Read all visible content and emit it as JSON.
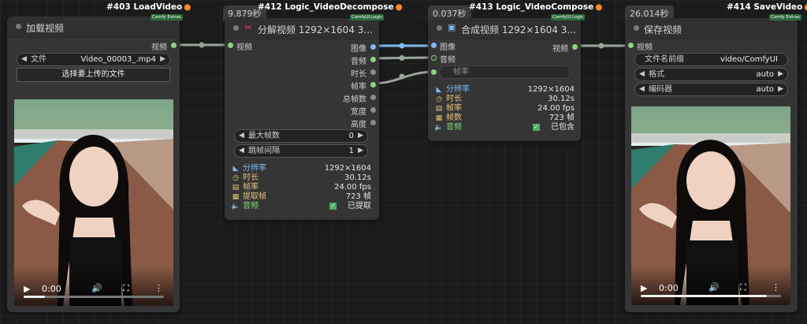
{
  "colors": {
    "accent_green": "#8cd37f",
    "accent_blue": "#7fb8ef",
    "node_bg": "#353535",
    "canvas_bg": "#1b1b1b"
  },
  "nodes": {
    "load_video": {
      "badge": "#403 LoadVideo",
      "tag": "Comfy Extras",
      "title": "加载视频",
      "output_label": "视频",
      "file_widget": {
        "label": "文件",
        "value": "Video_00003_.mp4"
      },
      "upload_button": "选择要上传的文件",
      "player": {
        "time": "0:00",
        "progress": 0.15
      }
    },
    "decompose": {
      "timing": "9.879秒",
      "badge": "#412 Logic_VideoDecompose",
      "tag": "ComfyUI.Logic",
      "title": "分解视频 1292×1604 3...",
      "input_label": "视频",
      "outputs": [
        "图像",
        "音频",
        "时长",
        "帧率",
        "总帧数",
        "宽度",
        "高度"
      ],
      "widgets": [
        {
          "label": "最大帧数",
          "value": "0"
        },
        {
          "label": "跳帧间隔",
          "value": "1"
        }
      ],
      "info": [
        {
          "icon": "ruler-icon",
          "key": "分辨率",
          "value": "1292×1604",
          "color": "#7fb8ef"
        },
        {
          "icon": "clock-icon",
          "key": "时长",
          "value": "30.12s",
          "color": "#e6c37a"
        },
        {
          "icon": "film-icon",
          "key": "帧率",
          "value": "24.00 fps",
          "color": "#e6c37a"
        },
        {
          "icon": "image-icon",
          "key": "提取帧",
          "value": "723 帧",
          "color": "#e6c37a"
        },
        {
          "icon": "speaker-icon",
          "key": "音频",
          "value": "已提取",
          "color": "#8cd37f"
        }
      ]
    },
    "compose": {
      "timing": "0.037秒",
      "badge": "#413 Logic_VideoCompose",
      "tag": "ComfyUI.Logic",
      "title": "合成视频 1292×1604 3...",
      "inputs": [
        "图像",
        "音频"
      ],
      "fps_placeholder": "帧率",
      "output_label": "视频",
      "info": [
        {
          "icon": "ruler-icon",
          "key": "分辨率",
          "value": "1292×1604",
          "color": "#7fb8ef"
        },
        {
          "icon": "clock-icon",
          "key": "时长",
          "value": "30.12s",
          "color": "#e6c37a"
        },
        {
          "icon": "film-icon",
          "key": "帧率",
          "value": "24.00 fps",
          "color": "#e6c37a"
        },
        {
          "icon": "image-icon",
          "key": "帧数",
          "value": "723 帧",
          "color": "#e6c37a"
        },
        {
          "icon": "speaker-icon",
          "key": "音频",
          "value": "已包含",
          "color": "#8cd37f"
        }
      ]
    },
    "save_video": {
      "timing": "26.014秒",
      "badge": "#414 SaveVideo",
      "tag": "Comfy Extras",
      "title": "保存视频",
      "input_label": "视频",
      "prefix_widget": {
        "label": "文件名前缀",
        "value": "video/ComfyUI"
      },
      "format_widget": {
        "label": "格式",
        "value": "auto"
      },
      "codec_widget": {
        "label": "编码器",
        "value": "auto"
      },
      "player": {
        "time": "0:00",
        "progress": 0.9
      }
    }
  }
}
